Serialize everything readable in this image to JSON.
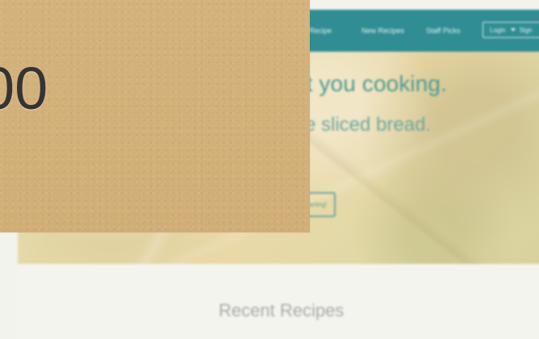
{
  "nav": {
    "items": [
      "y Recipe",
      "New Recipes",
      "Staff Picks"
    ],
    "login_label": "Login",
    "signup_label": "Sign"
  },
  "hero": {
    "title": "et you cooking.",
    "subtitle": "e sliced bread.",
    "button_label": "arting!"
  },
  "recent": {
    "title": "Recent Recipes"
  },
  "overlay": {
    "value": "00"
  }
}
